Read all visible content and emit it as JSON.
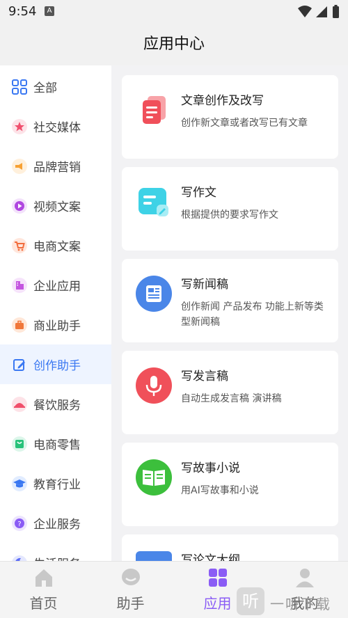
{
  "status_bar": {
    "time": "9:54",
    "notification_letter": "A"
  },
  "header": {
    "title": "应用中心"
  },
  "sidebar": {
    "items": [
      {
        "label": "全部",
        "icon": "grid-icon",
        "color": "#3a78f2",
        "active": false
      },
      {
        "label": "社交媒体",
        "icon": "star-icon",
        "color": "#f0506e",
        "active": false
      },
      {
        "label": "品牌营销",
        "icon": "megaphone-icon",
        "color": "#f7a134",
        "active": false
      },
      {
        "label": "视频文案",
        "icon": "play-icon",
        "color": "#b047e0",
        "active": false
      },
      {
        "label": "电商文案",
        "icon": "cart-icon",
        "color": "#f26d3d",
        "active": false
      },
      {
        "label": "企业应用",
        "icon": "building-icon",
        "color": "#c455e0",
        "active": false
      },
      {
        "label": "商业助手",
        "icon": "briefcase-icon",
        "color": "#f0773a",
        "active": false
      },
      {
        "label": "创作助手",
        "icon": "edit-icon",
        "color": "#3a78f2",
        "active": true
      },
      {
        "label": "餐饮服务",
        "icon": "dish-icon",
        "color": "#f04f6b",
        "active": false
      },
      {
        "label": "电商零售",
        "icon": "bag-icon",
        "color": "#27c27a",
        "active": false
      },
      {
        "label": "教育行业",
        "icon": "graduation-cap-icon",
        "color": "#3a78f2",
        "active": false
      },
      {
        "label": "企业服务",
        "icon": "question-icon",
        "color": "#8a5cf5",
        "active": false
      },
      {
        "label": "生活服务",
        "icon": "moon-icon",
        "color": "#5c6cf5",
        "active": false
      }
    ]
  },
  "cards": [
    {
      "title": "文章创作及改写",
      "desc": "创作新文章或者改写已有文章",
      "icon": "documents-icon",
      "color": "#f04f5a"
    },
    {
      "title": "写作文",
      "desc": "根据提供的要求写作文",
      "icon": "note-icon",
      "color": "#3ed2e6"
    },
    {
      "title": "写新闻稿",
      "desc": "创作新闻 产品发布 功能上新等类型新闻稿",
      "icon": "newspaper-icon",
      "color": "#4a86e8"
    },
    {
      "title": "写发言稿",
      "desc": "自动生成发言稿 演讲稿",
      "icon": "microphone-icon",
      "color": "#f0505a"
    },
    {
      "title": "写故事小说",
      "desc": "用AI写故事和小说",
      "icon": "book-icon",
      "color": "#3cbf3c"
    },
    {
      "title": "写论文大纲",
      "desc": "",
      "icon": "outline-icon",
      "color": "#4a86e8"
    }
  ],
  "tabbar": {
    "tabs": [
      {
        "label": "首页",
        "icon": "home-icon",
        "active": false
      },
      {
        "label": "助手",
        "icon": "chat-icon",
        "active": false
      },
      {
        "label": "应用",
        "icon": "apps-icon",
        "active": true
      },
      {
        "label": "我的",
        "icon": "user-icon",
        "active": false
      }
    ]
  },
  "watermark": {
    "glyph": "听",
    "text": "一听下载"
  },
  "colors": {
    "accent": "#3a78f2",
    "tab_active": "#8a5cf5",
    "sidebar_active_bg": "#eef4ff"
  }
}
